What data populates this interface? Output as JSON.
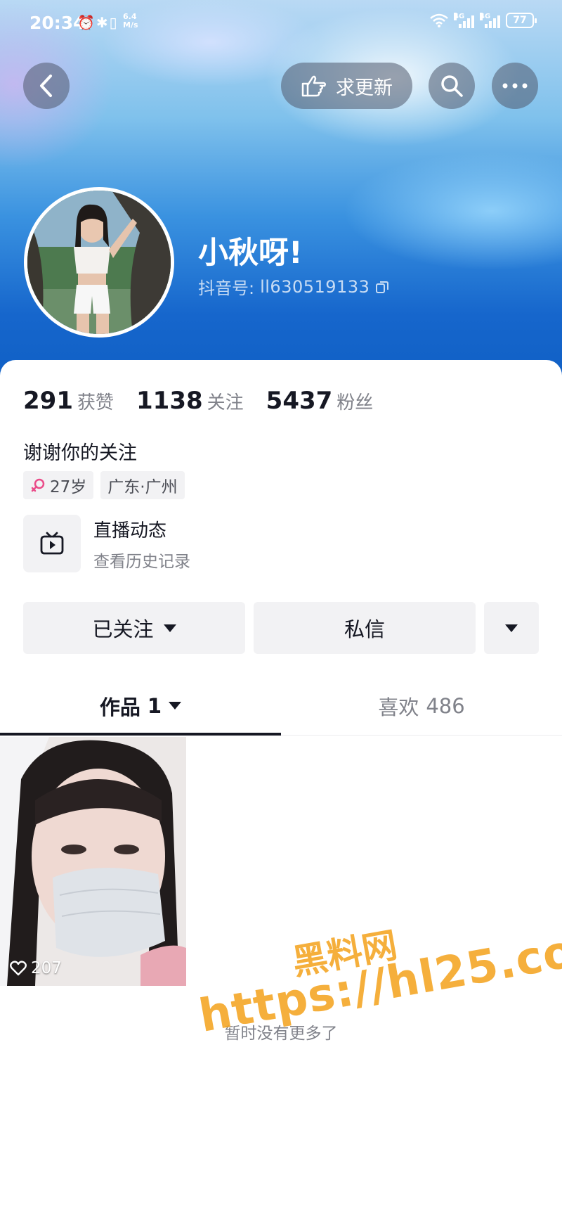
{
  "status_bar": {
    "time": "20:34",
    "net_speed": "6.4 M/s",
    "signal1_label": "4G",
    "signal2_label": "4G",
    "battery": "77"
  },
  "nav": {
    "update_label": "求更新"
  },
  "profile": {
    "nickname": "小秋呀!",
    "douyin_id_label": "抖音号:",
    "douyin_id": "ll630519133"
  },
  "stats": [
    {
      "num": "291",
      "label": "获赞"
    },
    {
      "num": "1138",
      "label": "关注"
    },
    {
      "num": "5437",
      "label": "粉丝"
    }
  ],
  "bio": "谢谢你的关注",
  "tags": {
    "age": "27岁",
    "location": "广东·广州"
  },
  "live": {
    "title": "直播动态",
    "subtitle": "查看历史记录"
  },
  "actions": {
    "follow_label": "已关注",
    "message_label": "私信"
  },
  "tabs": {
    "works_label": "作品",
    "works_count": "1",
    "likes_label": "喜欢",
    "likes_count": "486"
  },
  "videos": [
    {
      "likes": "207"
    }
  ],
  "footer_text": "暂时没有更多了",
  "watermark": {
    "title": "黑料网",
    "url": "https://hl25.co"
  },
  "colors": {
    "header_blue": "#1666cc",
    "watermark": "#f4a522",
    "gender_female": "#ea4c89"
  }
}
